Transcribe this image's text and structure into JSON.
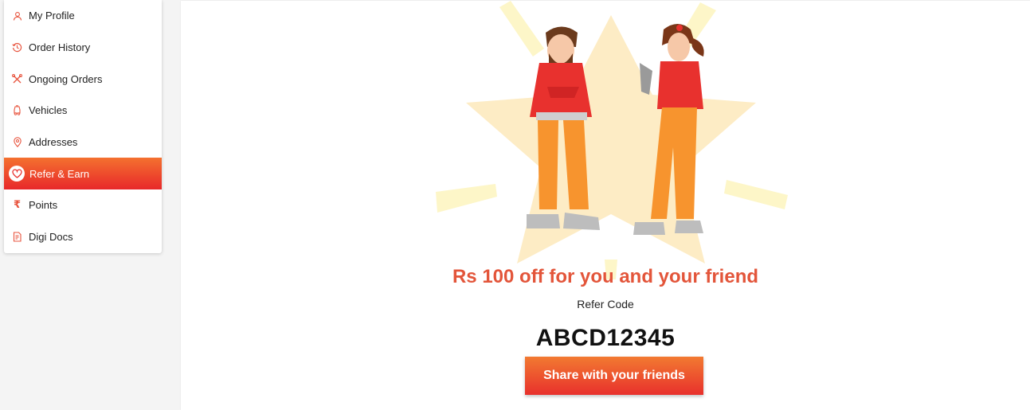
{
  "sidebar": {
    "items": [
      {
        "label": "My Profile",
        "icon": "user-icon"
      },
      {
        "label": "Order History",
        "icon": "history-icon"
      },
      {
        "label": "Ongoing Orders",
        "icon": "tools-icon"
      },
      {
        "label": "Vehicles",
        "icon": "vehicle-icon"
      },
      {
        "label": "Addresses",
        "icon": "location-pin-icon"
      },
      {
        "label": "Refer & Earn",
        "icon": "heart-icon",
        "active": true
      },
      {
        "label": "Points",
        "icon": "rupee-icon"
      },
      {
        "label": "Digi Docs",
        "icon": "document-icon"
      }
    ]
  },
  "refer": {
    "headline": "Rs 100 off for you and your friend",
    "code_label": "Refer Code",
    "code": "ABCD12345",
    "share_button": "Share with your friends"
  },
  "colors": {
    "accent_gradient_start": "#f4712f",
    "accent_gradient_end": "#e8282a",
    "headline": "#e3553a",
    "icon": "#e8553f"
  }
}
